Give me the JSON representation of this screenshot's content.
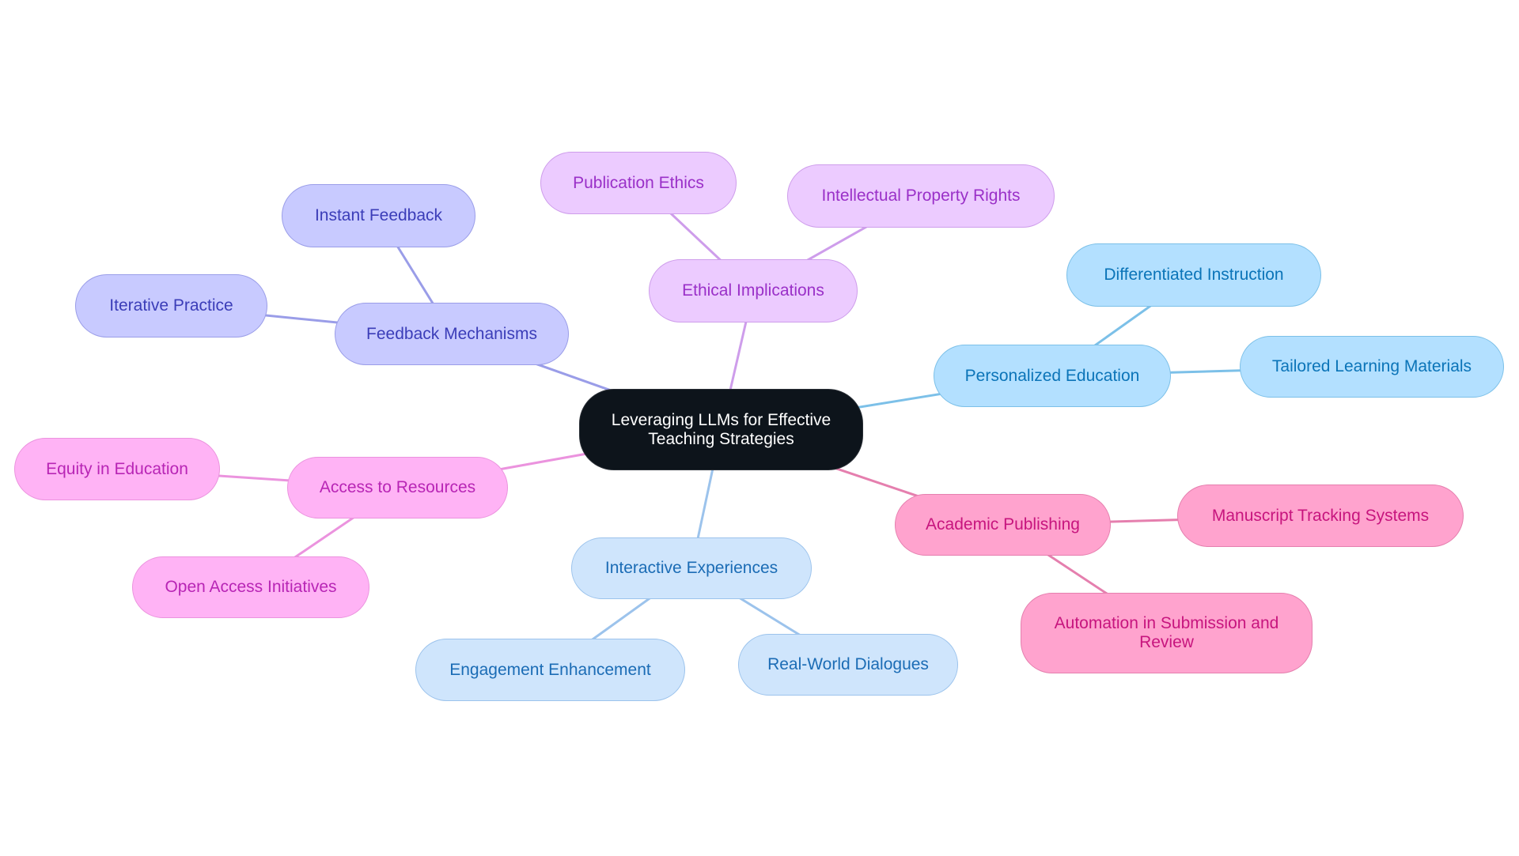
{
  "diagram": {
    "type": "mindmap",
    "root": {
      "id": "root",
      "label": "Leveraging LLMs for Effective\nTeaching Strategies",
      "fill": "#0D141B",
      "text": "#FFFFFF"
    },
    "branches": [
      {
        "id": "feedback",
        "label": "Feedback Mechanisms",
        "fill": "#C8CAFF",
        "border": "#9A9DE8",
        "text": "#3B3DB8",
        "edge": "#9A9DE8",
        "children": [
          {
            "id": "instant",
            "label": "Instant Feedback"
          },
          {
            "id": "iterative",
            "label": "Iterative Practice"
          }
        ]
      },
      {
        "id": "ethics",
        "label": "Ethical Implications",
        "fill": "#ECCBFF",
        "border": "#CE9DEB",
        "text": "#9A30C8",
        "edge": "#CE9DEB",
        "children": [
          {
            "id": "pubethics",
            "label": "Publication Ethics"
          },
          {
            "id": "iprights",
            "label": "Intellectual Property Rights"
          }
        ]
      },
      {
        "id": "personalized",
        "label": "Personalized Education",
        "fill": "#B3E0FF",
        "border": "#7CC0E8",
        "text": "#0B74B8",
        "edge": "#7CC0E8",
        "children": [
          {
            "id": "differentiated",
            "label": "Differentiated Instruction"
          },
          {
            "id": "tailored",
            "label": "Tailored Learning Materials"
          }
        ]
      },
      {
        "id": "academic",
        "label": "Academic Publishing",
        "fill": "#FFA3CE",
        "border": "#E57FAE",
        "text": "#C7157E",
        "edge": "#E57FAE",
        "children": [
          {
            "id": "manuscript",
            "label": "Manuscript Tracking Systems"
          },
          {
            "id": "automation",
            "label": "Automation in Submission and\nReview"
          }
        ]
      },
      {
        "id": "interactive",
        "label": "Interactive Experiences",
        "fill": "#CFE5FC",
        "border": "#9CC3EC",
        "text": "#1B6CB5",
        "edge": "#9CC3EC",
        "children": [
          {
            "id": "engagement",
            "label": "Engagement Enhancement"
          },
          {
            "id": "realworld",
            "label": "Real-World Dialogues"
          }
        ]
      },
      {
        "id": "access",
        "label": "Access to Resources",
        "fill": "#FFB3F5",
        "border": "#EB93DE",
        "text": "#B825B5",
        "edge": "#EB93DE",
        "children": [
          {
            "id": "equity",
            "label": "Equity in Education"
          },
          {
            "id": "openaccess",
            "label": "Open Access Initiatives"
          }
        ]
      }
    ]
  }
}
